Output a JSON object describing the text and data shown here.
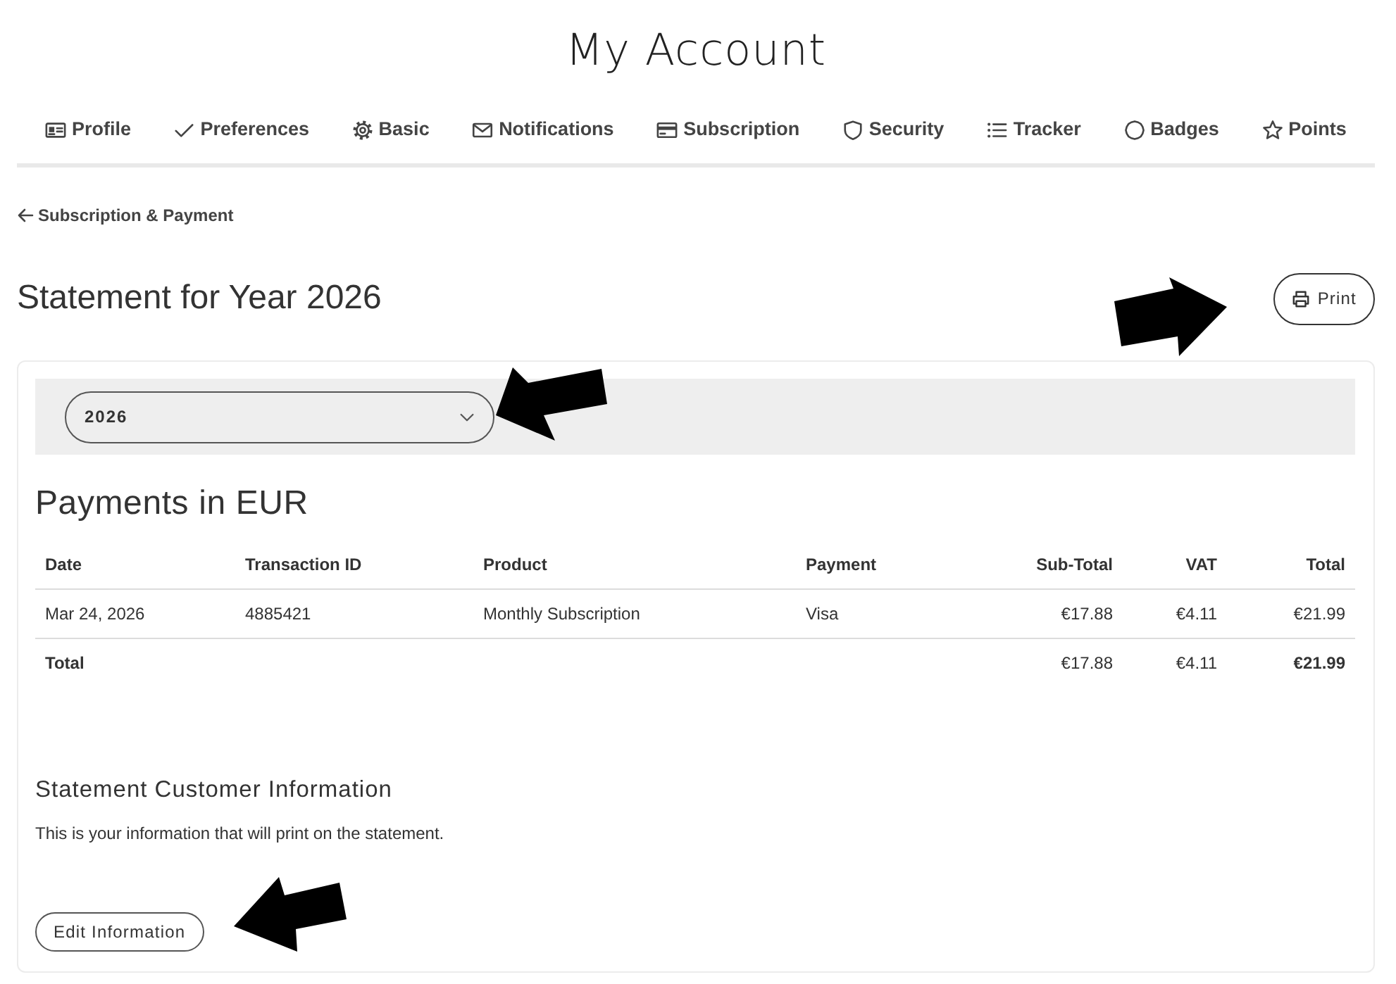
{
  "header": {
    "title": "My Account"
  },
  "tabs": [
    {
      "label": "Profile"
    },
    {
      "label": "Preferences"
    },
    {
      "label": "Basic"
    },
    {
      "label": "Notifications"
    },
    {
      "label": "Subscription"
    },
    {
      "label": "Security"
    },
    {
      "label": "Tracker"
    },
    {
      "label": "Badges"
    },
    {
      "label": "Points"
    }
  ],
  "back_link": {
    "label": "Subscription & Payment"
  },
  "statement": {
    "title": "Statement for Year 2026",
    "print_button": "Print"
  },
  "year_select": {
    "value": "2026"
  },
  "payments": {
    "title": "Payments in EUR",
    "columns": [
      {
        "label": "Date",
        "kind": "text"
      },
      {
        "label": "Transaction ID",
        "kind": "text"
      },
      {
        "label": "Product",
        "kind": "text"
      },
      {
        "label": "Payment",
        "kind": "text"
      },
      {
        "label": "Sub-Total",
        "kind": "amount"
      },
      {
        "label": "VAT",
        "kind": "amount"
      },
      {
        "label": "Total",
        "kind": "amount"
      }
    ],
    "rows": [
      {
        "cells": [
          "Mar 24, 2026",
          "4885421",
          "Monthly Subscription",
          "Visa",
          "€17.88",
          "€4.11",
          "€21.99"
        ]
      }
    ],
    "total_row": {
      "label": "Total",
      "sub_total": "€17.88",
      "vat": "€4.11",
      "total": "€21.99"
    }
  },
  "customer_info": {
    "title": "Statement Customer Information",
    "text": "This is your information that will print on the statement.",
    "edit_button": "Edit Information"
  }
}
